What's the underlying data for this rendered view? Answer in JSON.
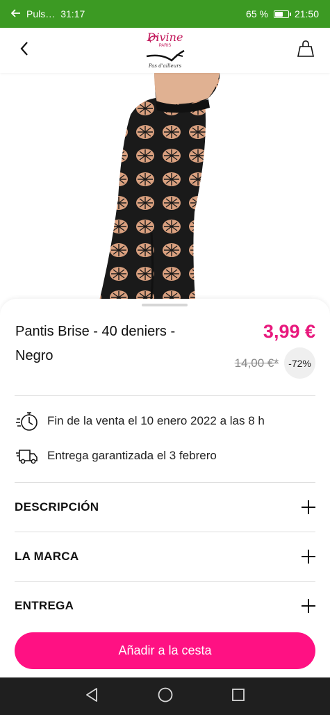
{
  "status_bar": {
    "left_text": "Puls…",
    "call_time": "31:17",
    "battery_percent": "65 %",
    "battery_level": 0.65,
    "clock": "21:50"
  },
  "header": {
    "back_icon": "chevron-left-icon",
    "logo": {
      "wordmark": "Divine",
      "sub": "PARIS",
      "tagline": "Pas d'ailleurs"
    },
    "cart_icon": "shopping-bag-icon"
  },
  "product": {
    "image_alt": "tights-photo",
    "title": "Pantis Brise - 40 deniers - Negro",
    "price": "3,99 €",
    "old_price": "14,00 €*",
    "discount": "-72%"
  },
  "info": [
    {
      "icon": "stopwatch-icon",
      "text": "Fin de la venta el 10 enero 2022 a las 8 h"
    },
    {
      "icon": "delivery-truck-icon",
      "text": "Entrega garantizada el 3 febrero"
    }
  ],
  "accordions": [
    {
      "label": "DESCRIPCIÓN"
    },
    {
      "label": "LA MARCA"
    },
    {
      "label": "ENTREGA"
    }
  ],
  "cta": {
    "label": "Añadir a la cesta"
  },
  "colors": {
    "status_bar": "#3c9a23",
    "accent": "#ff1183",
    "price": "#e8197d",
    "nav_bar": "#1f1f1f"
  },
  "nav": {
    "back": "triangle-back-icon",
    "home": "circle-home-icon",
    "recents": "square-recents-icon"
  }
}
